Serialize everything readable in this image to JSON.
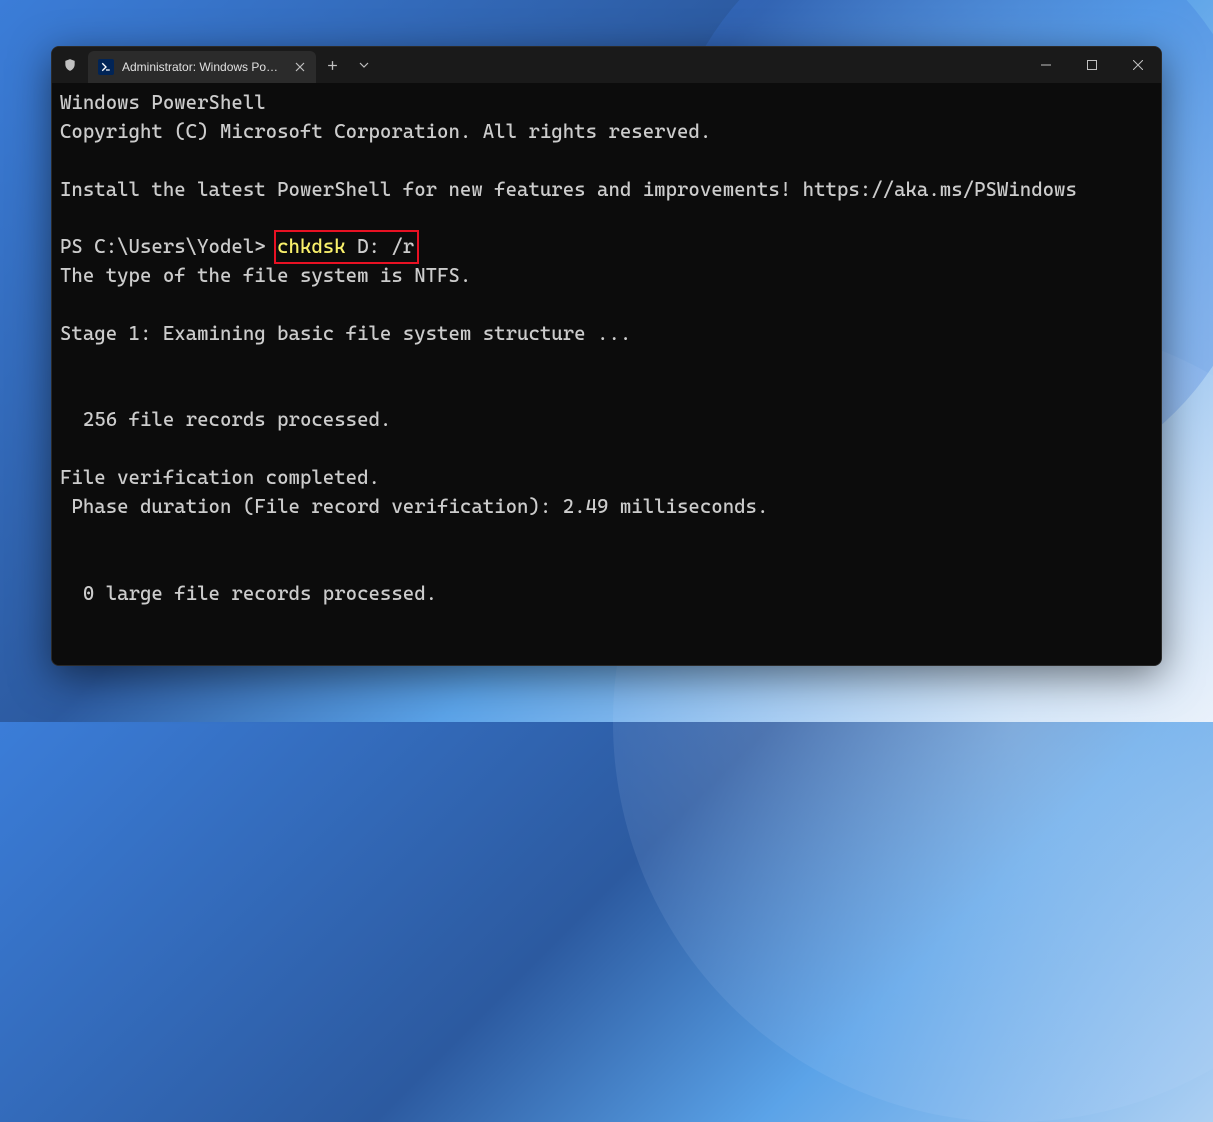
{
  "window": {
    "tab_title": "Administrator: Windows PowerShell"
  },
  "terminal": {
    "header1": "Windows PowerShell",
    "header2": "Copyright (C) Microsoft Corporation. All rights reserved.",
    "install_hint": "Install the latest PowerShell for new features and improvements! https://aka.ms/PSWindows",
    "prompt_prefix": "PS C:\\Users\\Yodel> ",
    "cmd_name": "chkdsk",
    "cmd_args": " D: /r",
    "out_line1": "The type of the file system is NTFS.",
    "out_line2": "Stage 1: Examining basic file system structure ...",
    "out_line3": "  256 file records processed.",
    "out_line4": "File verification completed.",
    "out_line5": " Phase duration (File record verification): 2.49 milliseconds.",
    "out_line6": "  0 large file records processed."
  }
}
